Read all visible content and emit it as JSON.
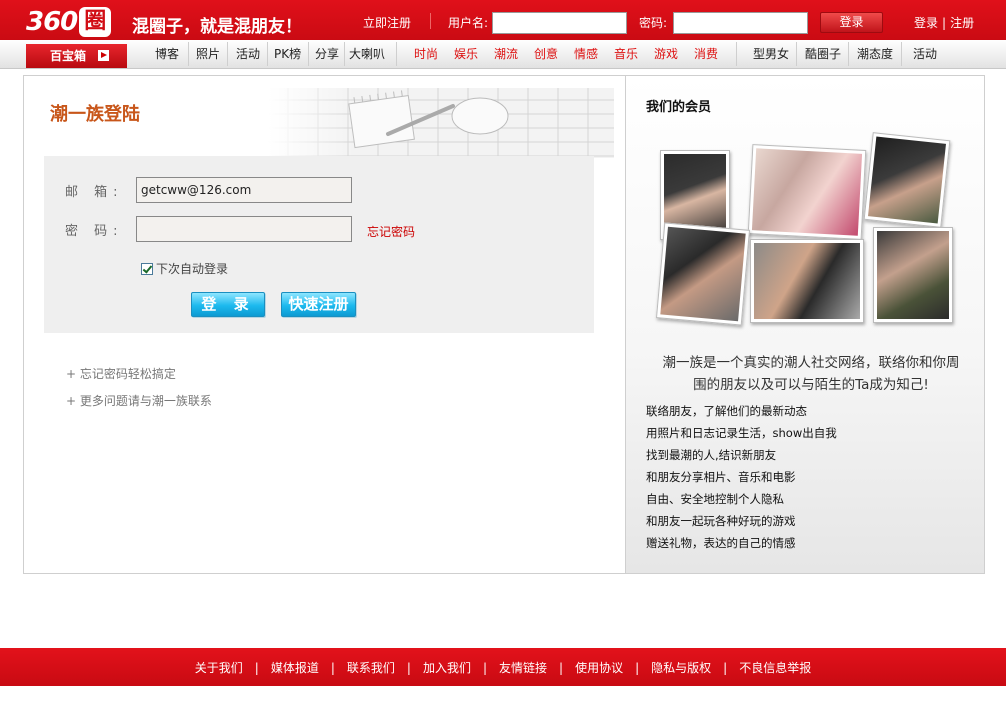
{
  "header": {
    "logo_num": "360",
    "logo_char": "圈",
    "slogan": "混圈子，就是混朋友！",
    "register_now": "立即注册",
    "username_label": "用户名:",
    "password_label": "密码:",
    "login_button": "登录",
    "link_login": "登录",
    "link_separator": "|",
    "link_register": "注册"
  },
  "nav": {
    "baobox": "百宝箱",
    "group1": [
      "博客",
      "照片",
      "活动",
      "PK榜",
      "分享",
      "大喇叭"
    ],
    "group2": [
      "时尚",
      "娱乐",
      "潮流",
      "创意",
      "情感",
      "音乐",
      "游戏",
      "消费"
    ],
    "group3": [
      "型男女",
      "酷圈子",
      "潮态度",
      "活动"
    ]
  },
  "login": {
    "title": "潮一族登陆",
    "email_label": "邮 箱:",
    "email_value": "getcww@126.com",
    "password_label": "密 码:",
    "forgot_password": "忘记密码",
    "remember_me": "下次自动登录",
    "login_button": "登 录",
    "quick_register_button": "快速注册",
    "help_1": "+ 忘记密码轻松搞定",
    "help_2": "+ 更多问题请与潮一族联系"
  },
  "members": {
    "title": "我们的会员",
    "intro": "潮一族是一个真实的潮人社交网络，联络你和你周围的朋友以及可以与陌生的Ta成为知己!",
    "features": [
      "联络朋友，了解他们的最新动态",
      "用照片和日志记录生活，show出自我",
      "找到最潮的人,结识新朋友",
      "和朋友分享相片、音乐和电影",
      "自由、安全地控制个人隐私",
      "和朋友一起玩各种好玩的游戏",
      "赠送礼物，表达的自己的情感"
    ]
  },
  "footer": {
    "links": [
      "关于我们",
      "媒体报道",
      "联系我们",
      "加入我们",
      "友情链接",
      "使用协议",
      "隐私与版权",
      "不良信息举报"
    ]
  },
  "colors": {
    "brand_red": "#d10d15",
    "title_orange": "#c8561a",
    "button_blue": "#1cb9ee"
  }
}
